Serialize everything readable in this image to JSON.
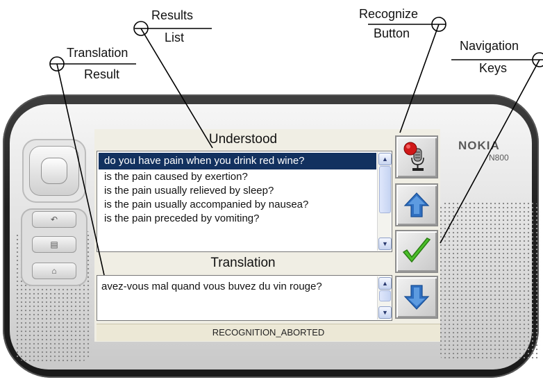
{
  "device": {
    "brand": "NOKIA",
    "model": "N800",
    "side_keys": [
      "↶",
      "▤",
      "⌂"
    ]
  },
  "callouts": {
    "results_list": {
      "line1": "Results",
      "line2": "List"
    },
    "recognize_button": {
      "line1": "Recognize",
      "line2": "Button"
    },
    "translation_result": {
      "line1": "Translation",
      "line2": "Result"
    },
    "navigation_keys": {
      "line1": "Navigation",
      "line2": "Keys"
    }
  },
  "screen": {
    "understood_header": "Understood",
    "results": [
      "do you have pain when you drink red wine?",
      "is the pain caused by exertion?",
      "is the pain usually relieved by sleep?",
      "is the pain usually accompanied by nausea?",
      "is the pain preceded by vomiting?"
    ],
    "selected_index": 0,
    "translation_header": "Translation",
    "translation_text": "avez-vous mal quand vous buvez du vin rouge?",
    "status": "RECOGNITION_ABORTED"
  },
  "buttons": {
    "recognize_icon": "microphone-record-icon",
    "up_icon": "arrow-up-icon",
    "ok_icon": "checkmark-icon",
    "down_icon": "arrow-down-icon"
  },
  "colors": {
    "selection": "#12315f",
    "status_bar": "#ece8d6",
    "arrow_blue": "#2f6fc0",
    "check_green": "#4bbf2a",
    "record_red": "#d01818"
  }
}
